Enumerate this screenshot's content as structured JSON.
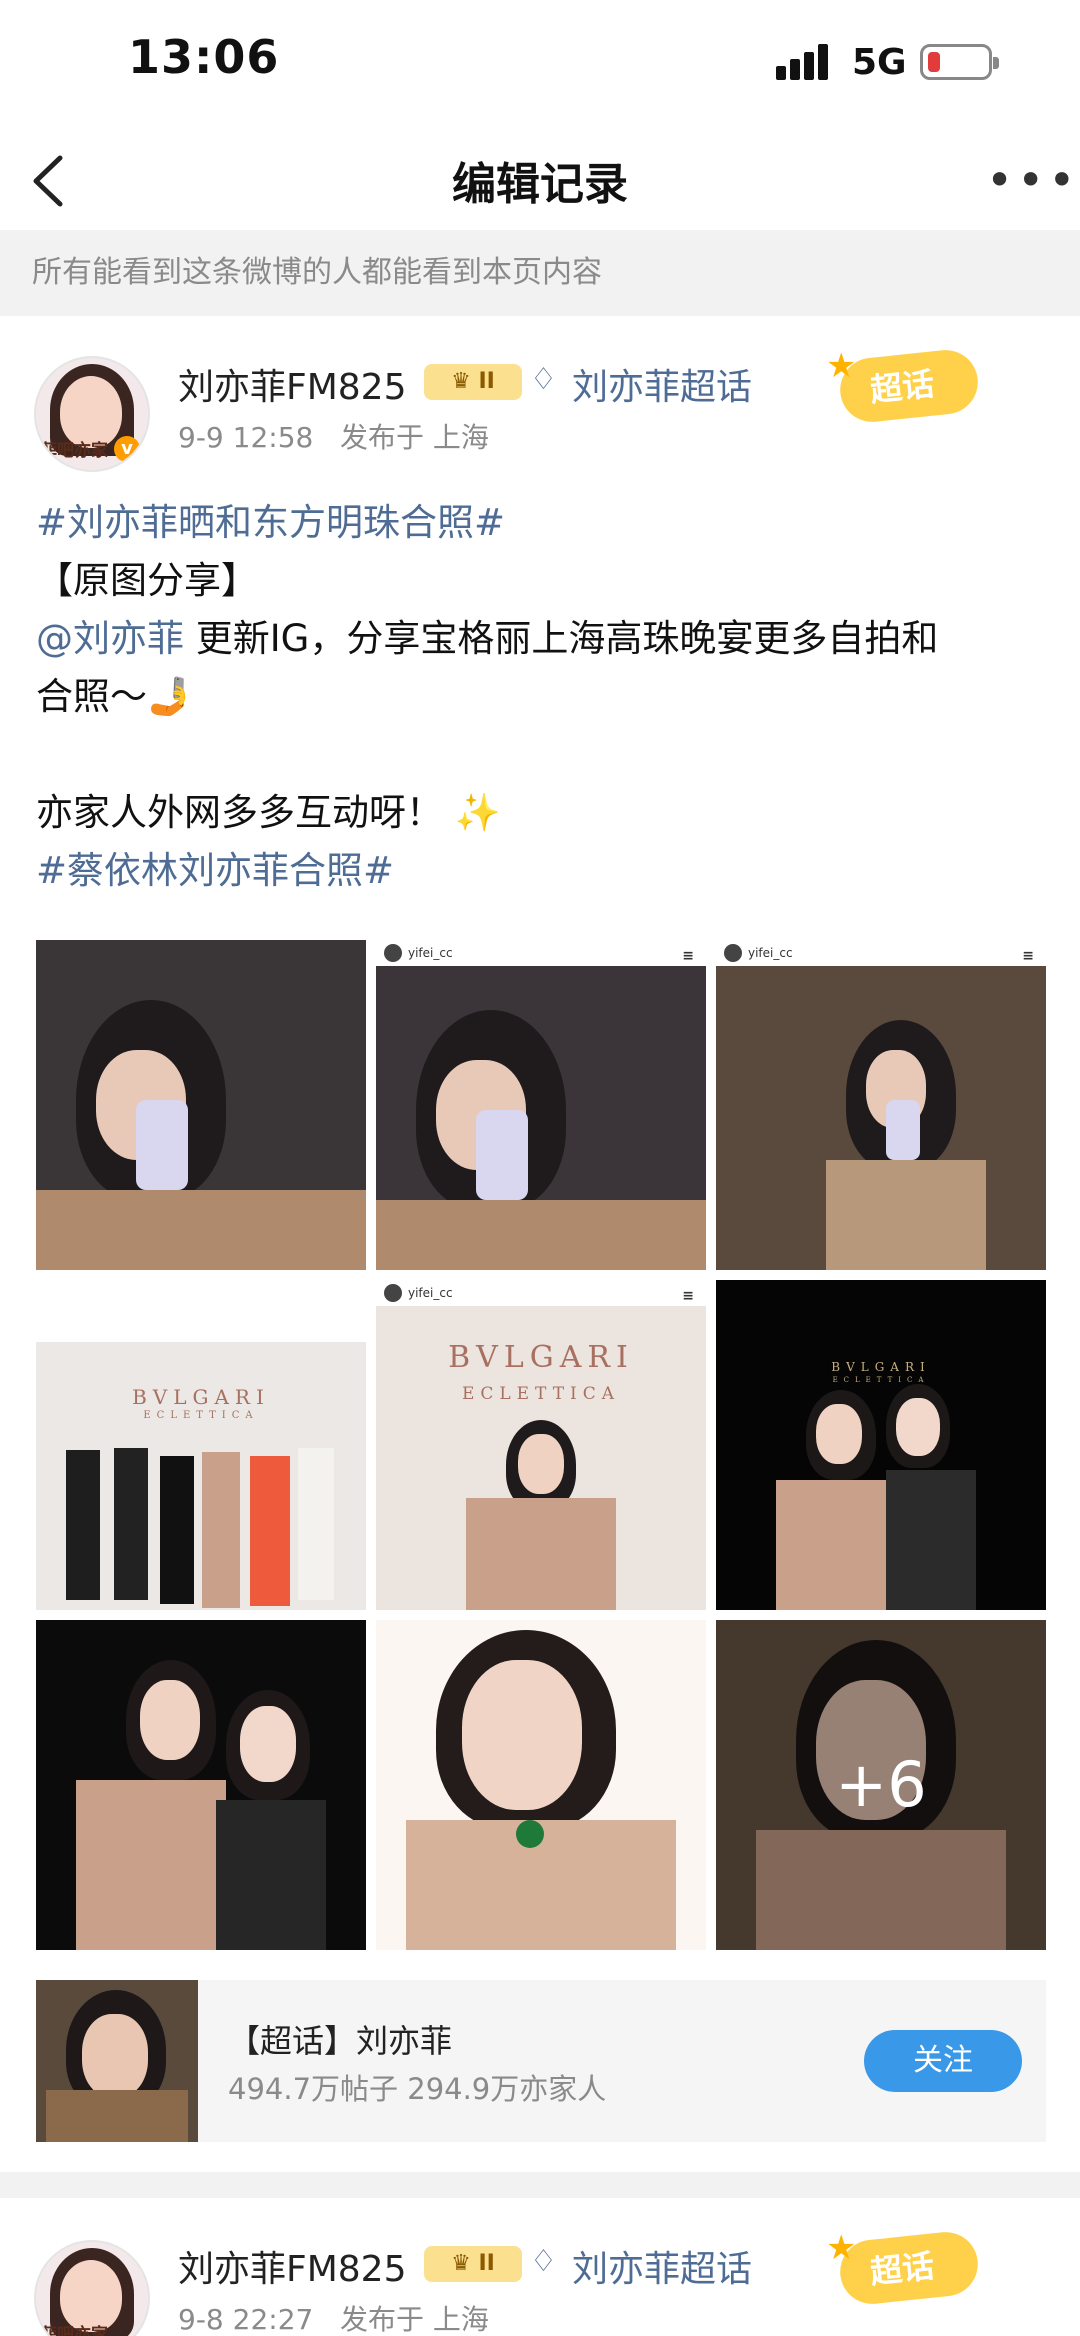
{
  "status_bar": {
    "time": "13:06",
    "network": "5G"
  },
  "nav": {
    "title": "编辑记录"
  },
  "notice": "所有能看到这条微博的人都能看到本页内容",
  "posts": [
    {
      "author": "刘亦菲FM825",
      "level_badge": "♛ II",
      "super_topic": "刘亦菲超话",
      "date": "9-9 12:58",
      "location": "发布于 上海",
      "stamp": "超话",
      "avatar_tag": "菲吧亦家",
      "lines": {
        "hashtag1": "#刘亦菲晒和东方明珠合照#",
        "tag_line": "【原图分享】",
        "mention": "@刘亦菲",
        "body1": " 更新IG，分享宝格丽上海高珠晚宴更多自拍和",
        "body2": "合照～🤳",
        "body3": "亦家人外网多多互动呀！ ✨",
        "hashtag2": "#蔡依林刘亦菲合照#"
      },
      "images": {
        "ig_handle": "yifei_cc",
        "brand": "BVLGARI",
        "collection": "ECLETTICA",
        "more_count": "+6"
      },
      "topic_card": {
        "title": "【超话】刘亦菲",
        "stats": "494.7万帖子 294.9万亦家人",
        "follow_label": "关注"
      }
    },
    {
      "author": "刘亦菲FM825",
      "level_badge": "♛ II",
      "super_topic": "刘亦菲超话",
      "date": "9-8 22:27",
      "location": "发布于 上海",
      "stamp": "超话",
      "avatar_tag": "菲吧亦家"
    }
  ],
  "colors": {
    "link": "#4f6c95",
    "follow_button": "#3a98e8",
    "badge": "#fbe090"
  }
}
